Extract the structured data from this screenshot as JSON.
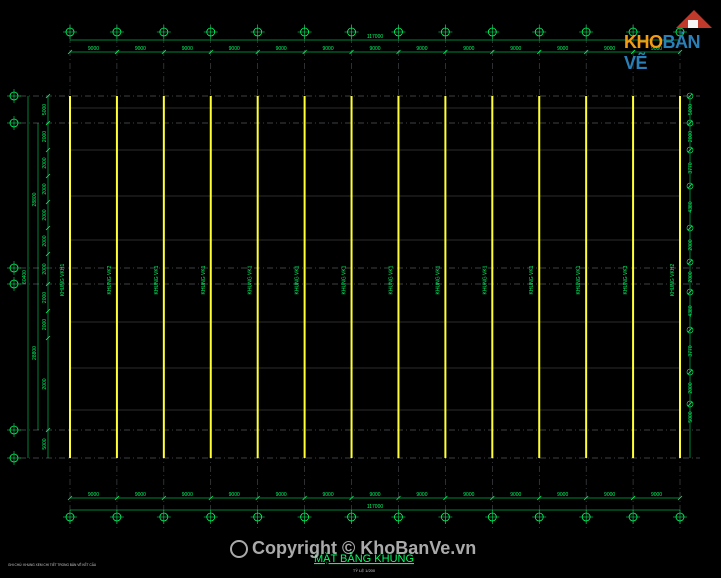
{
  "drawing": {
    "title": "MẶT BẰNG KHUNG",
    "scale": "TỶ LỆ 1/200",
    "top_total": "117000",
    "bottom_total": "117000",
    "bay_dims": [
      "9000",
      "9000",
      "9000",
      "9000",
      "9000",
      "9000",
      "9000",
      "9000",
      "9000",
      "9000",
      "9000",
      "9000",
      "9000"
    ],
    "frame_labels": [
      "KHUNG VKH1",
      "KHUNG VK2",
      "KHUNG VK1",
      "KHUNG VK1",
      "KHUNG VK1",
      "KHUNG VK1",
      "KHUNG VK1",
      "KHUNG VK1",
      "KHUNG VK1",
      "KHUNG VK1",
      "KHUNG VK1",
      "KHUNG VK1",
      "KHUNG VK3",
      "KHUNG VKH2"
    ],
    "left_dims": [
      "5000",
      "2000",
      "2000",
      "2000",
      "2000",
      "2000",
      "2000",
      "2000",
      "2000",
      "2000",
      "5000"
    ],
    "left_group_dims": [
      "28800",
      "28800"
    ],
    "left_total": "60400",
    "right_dims": [
      "5000",
      "2000",
      "3770",
      "4380",
      "2000",
      "2000",
      "4380",
      "3770",
      "2000",
      "5000"
    ],
    "footnote": "GHI CHÚ: KHUNG XEM CHI TIẾT TRONG BẢN VẼ KẾT CẤU",
    "colors": {
      "frame": "#ffff33",
      "dim": "#00ff66",
      "grid": "#9aa0a6",
      "title": "#00ff66"
    }
  },
  "brand": {
    "logo_part1": "KHO",
    "logo_part2": "BẢN VẼ",
    "logo_color1": "#f39c12",
    "logo_color2": "#2980b9"
  },
  "watermark": {
    "text": "Copyright © KhoBanVe.vn"
  }
}
